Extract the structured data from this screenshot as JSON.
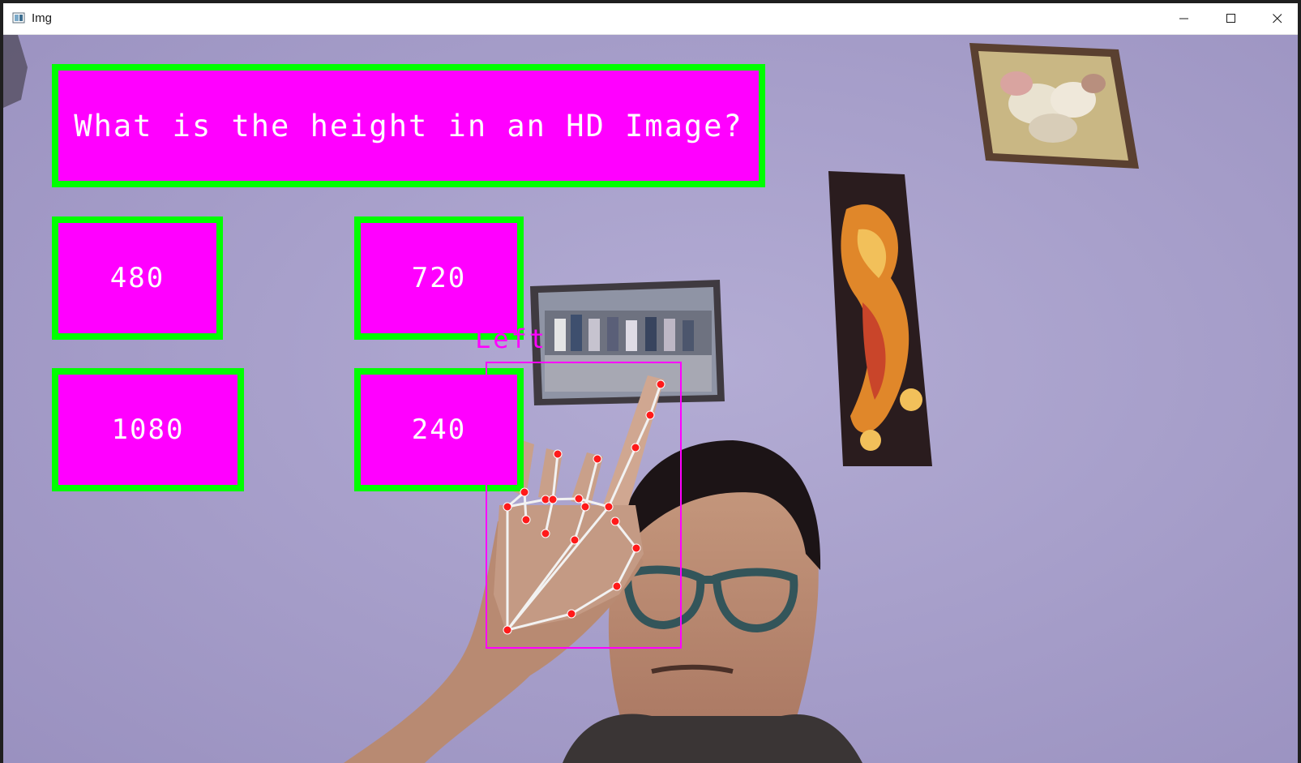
{
  "window": {
    "title": "Img",
    "controls": {
      "minimize": "minimize-icon",
      "maximize": "maximize-icon",
      "close": "close-icon"
    }
  },
  "quiz": {
    "question": "What is the height in an HD Image?",
    "options": [
      "480",
      "720",
      "1080",
      "240"
    ]
  },
  "hand": {
    "label": "Left"
  },
  "colors": {
    "box_fill": "#ff00ff",
    "box_border": "#00ff00",
    "box_text": "#ffffff",
    "hand_bbox": "#ff00ff",
    "landmark_point": "#ff0000",
    "landmark_line": "#ffffff",
    "wall": "#a9a0cb"
  }
}
